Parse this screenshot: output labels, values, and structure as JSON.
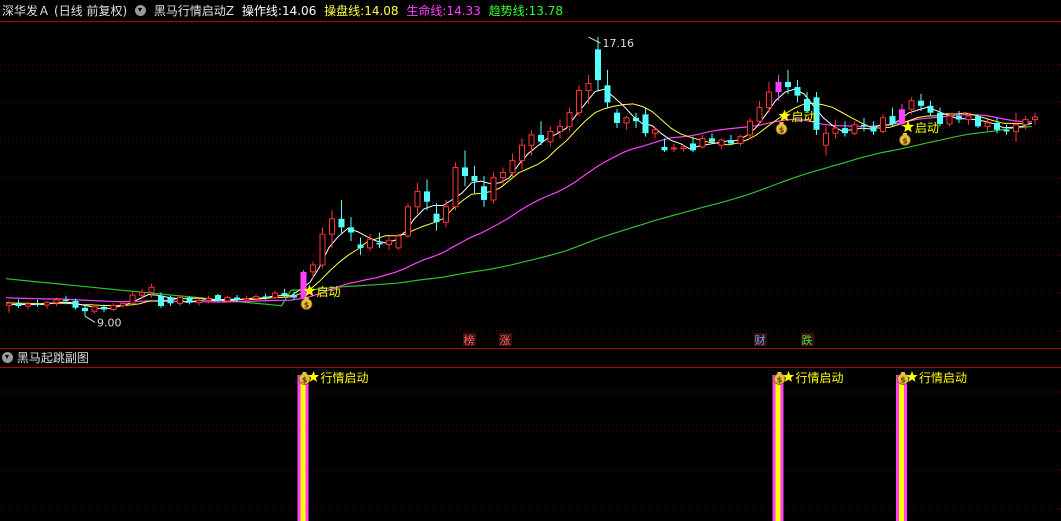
{
  "header": {
    "stock_name": "深华发Ａ",
    "period": "(日线 前复权)",
    "indicator_name": "黑马行情启动Z",
    "lines": [
      {
        "label": "操作线:",
        "value": "14.06",
        "color": "#ffffff"
      },
      {
        "label": "操盘线:",
        "value": "14.08",
        "color": "#ffff40"
      },
      {
        "label": "生命线:",
        "value": "14.33",
        "color": "#ff40ff"
      },
      {
        "label": "趋势线:",
        "value": "13.78",
        "color": "#30ff30"
      }
    ]
  },
  "subpanel": {
    "title": "黑马起跳副图"
  },
  "annotations": {
    "high_label": "17.16",
    "low_label": "9.00",
    "signal_text": "启动",
    "sub_signal_text": "行情启动",
    "tags": [
      {
        "text": "榜",
        "color": "#ff6060"
      },
      {
        "text": "涨",
        "color": "#ff6060"
      },
      {
        "text": "财",
        "color": "#6aa0ff"
      },
      {
        "text": "跌",
        "color": "#40e040"
      }
    ]
  },
  "colors": {
    "up": "#ff3232",
    "down": "#54ffff",
    "grid": "#7a0000",
    "divider": "#b40000",
    "signal_bar": "#ff40ff",
    "sub_bar_outer": "#ff40ff",
    "sub_bar_inner": "#ffff00",
    "star": "#ffff00",
    "bag": "#e8c040"
  },
  "chart_data": {
    "type": "candlestick",
    "y_range": [
      8.6,
      17.6
    ],
    "candles": [
      {
        "o": 9.32,
        "h": 9.45,
        "l": 9.1,
        "c": 9.38
      },
      {
        "o": 9.38,
        "h": 9.5,
        "l": 9.25,
        "c": 9.3
      },
      {
        "o": 9.3,
        "h": 9.42,
        "l": 9.2,
        "c": 9.36
      },
      {
        "o": 9.36,
        "h": 9.48,
        "l": 9.28,
        "c": 9.33
      },
      {
        "o": 9.33,
        "h": 9.45,
        "l": 9.22,
        "c": 9.4
      },
      {
        "o": 9.4,
        "h": 9.55,
        "l": 9.3,
        "c": 9.48
      },
      {
        "o": 9.48,
        "h": 9.6,
        "l": 9.35,
        "c": 9.45
      },
      {
        "o": 9.45,
        "h": 9.52,
        "l": 9.2,
        "c": 9.25
      },
      {
        "o": 9.25,
        "h": 9.35,
        "l": 9.0,
        "c": 9.15
      },
      {
        "o": 9.15,
        "h": 9.35,
        "l": 9.08,
        "c": 9.28
      },
      {
        "o": 9.28,
        "h": 9.34,
        "l": 9.12,
        "c": 9.2
      },
      {
        "o": 9.2,
        "h": 9.38,
        "l": 9.15,
        "c": 9.32
      },
      {
        "o": 9.32,
        "h": 9.45,
        "l": 9.26,
        "c": 9.38
      },
      {
        "o": 9.38,
        "h": 9.7,
        "l": 9.3,
        "c": 9.62
      },
      {
        "o": 9.62,
        "h": 9.8,
        "l": 9.5,
        "c": 9.7
      },
      {
        "o": 9.7,
        "h": 9.95,
        "l": 9.55,
        "c": 9.85
      },
      {
        "o": 9.6,
        "h": 9.7,
        "l": 9.25,
        "c": 9.3
      },
      {
        "o": 9.55,
        "h": 9.6,
        "l": 9.3,
        "c": 9.38
      },
      {
        "o": 9.38,
        "h": 9.62,
        "l": 9.3,
        "c": 9.55
      },
      {
        "o": 9.55,
        "h": 9.58,
        "l": 9.35,
        "c": 9.4
      },
      {
        "o": 9.4,
        "h": 9.52,
        "l": 9.32,
        "c": 9.46
      },
      {
        "o": 9.46,
        "h": 9.6,
        "l": 9.38,
        "c": 9.52
      },
      {
        "o": 9.62,
        "h": 9.66,
        "l": 9.42,
        "c": 9.45
      },
      {
        "o": 9.45,
        "h": 9.6,
        "l": 9.4,
        "c": 9.55
      },
      {
        "o": 9.55,
        "h": 9.62,
        "l": 9.42,
        "c": 9.48
      },
      {
        "o": 9.48,
        "h": 9.6,
        "l": 9.4,
        "c": 9.52
      },
      {
        "o": 9.52,
        "h": 9.64,
        "l": 9.44,
        "c": 9.58
      },
      {
        "o": 9.58,
        "h": 9.66,
        "l": 9.48,
        "c": 9.55
      },
      {
        "o": 9.55,
        "h": 9.75,
        "l": 9.5,
        "c": 9.68
      },
      {
        "o": 9.68,
        "h": 9.8,
        "l": 9.56,
        "c": 9.62
      },
      {
        "o": 9.62,
        "h": 9.72,
        "l": 9.5,
        "c": 9.55
      },
      {
        "o": 9.52,
        "h": 10.35,
        "l": 9.5,
        "c": 10.3
      },
      {
        "o": 10.3,
        "h": 10.6,
        "l": 10.1,
        "c": 10.5
      },
      {
        "o": 10.5,
        "h": 11.6,
        "l": 10.4,
        "c": 11.4
      },
      {
        "o": 11.4,
        "h": 12.1,
        "l": 11.0,
        "c": 11.85
      },
      {
        "o": 11.85,
        "h": 12.4,
        "l": 11.4,
        "c": 11.6
      },
      {
        "o": 11.6,
        "h": 11.9,
        "l": 11.2,
        "c": 11.45
      },
      {
        "o": 11.1,
        "h": 11.3,
        "l": 10.8,
        "c": 11.0
      },
      {
        "o": 11.0,
        "h": 11.4,
        "l": 10.9,
        "c": 11.25
      },
      {
        "o": 11.15,
        "h": 11.45,
        "l": 11.0,
        "c": 11.1
      },
      {
        "o": 11.1,
        "h": 11.35,
        "l": 10.95,
        "c": 11.22
      },
      {
        "o": 11.0,
        "h": 11.4,
        "l": 10.95,
        "c": 11.35
      },
      {
        "o": 11.35,
        "h": 12.3,
        "l": 11.3,
        "c": 12.2
      },
      {
        "o": 12.2,
        "h": 12.9,
        "l": 12.0,
        "c": 12.65
      },
      {
        "o": 12.65,
        "h": 13.0,
        "l": 12.1,
        "c": 12.35
      },
      {
        "o": 12.0,
        "h": 12.3,
        "l": 11.5,
        "c": 11.75
      },
      {
        "o": 11.75,
        "h": 12.4,
        "l": 11.6,
        "c": 12.2
      },
      {
        "o": 12.2,
        "h": 13.5,
        "l": 12.1,
        "c": 13.35
      },
      {
        "o": 13.35,
        "h": 13.85,
        "l": 12.8,
        "c": 13.1
      },
      {
        "o": 13.1,
        "h": 13.4,
        "l": 12.6,
        "c": 12.95
      },
      {
        "o": 12.8,
        "h": 13.1,
        "l": 12.2,
        "c": 12.4
      },
      {
        "o": 12.4,
        "h": 13.2,
        "l": 12.3,
        "c": 13.05
      },
      {
        "o": 13.05,
        "h": 13.35,
        "l": 12.85,
        "c": 13.2
      },
      {
        "o": 13.2,
        "h": 13.75,
        "l": 13.05,
        "c": 13.55
      },
      {
        "o": 13.55,
        "h": 14.2,
        "l": 13.3,
        "c": 14.0
      },
      {
        "o": 14.0,
        "h": 14.45,
        "l": 13.7,
        "c": 14.3
      },
      {
        "o": 14.3,
        "h": 14.7,
        "l": 14.0,
        "c": 14.1
      },
      {
        "o": 14.1,
        "h": 14.55,
        "l": 13.95,
        "c": 14.4
      },
      {
        "o": 14.4,
        "h": 14.75,
        "l": 14.2,
        "c": 14.55
      },
      {
        "o": 14.55,
        "h": 15.1,
        "l": 14.4,
        "c": 14.95
      },
      {
        "o": 14.95,
        "h": 15.75,
        "l": 14.85,
        "c": 15.6
      },
      {
        "o": 15.6,
        "h": 16.05,
        "l": 15.2,
        "c": 15.8
      },
      {
        "o": 16.8,
        "h": 17.16,
        "l": 15.6,
        "c": 15.9
      },
      {
        "o": 15.75,
        "h": 16.2,
        "l": 15.1,
        "c": 15.25
      },
      {
        "o": 14.95,
        "h": 15.05,
        "l": 14.5,
        "c": 14.65
      },
      {
        "o": 14.65,
        "h": 14.85,
        "l": 14.45,
        "c": 14.8
      },
      {
        "o": 14.8,
        "h": 14.95,
        "l": 14.5,
        "c": 14.7
      },
      {
        "o": 14.9,
        "h": 15.1,
        "l": 14.25,
        "c": 14.35
      },
      {
        "o": 14.35,
        "h": 14.55,
        "l": 14.2,
        "c": 14.45
      },
      {
        "o": 13.95,
        "h": 14.2,
        "l": 13.8,
        "c": 13.85
      },
      {
        "o": 13.9,
        "h": 14.05,
        "l": 13.8,
        "c": 13.92
      },
      {
        "o": 13.9,
        "h": 14.0,
        "l": 13.82,
        "c": 13.95
      },
      {
        "o": 14.05,
        "h": 14.25,
        "l": 13.8,
        "c": 13.85
      },
      {
        "o": 13.95,
        "h": 14.3,
        "l": 13.9,
        "c": 14.2
      },
      {
        "o": 14.2,
        "h": 14.35,
        "l": 14.05,
        "c": 14.1
      },
      {
        "o": 14.0,
        "h": 14.2,
        "l": 13.9,
        "c": 14.15
      },
      {
        "o": 14.15,
        "h": 14.3,
        "l": 14.0,
        "c": 14.05
      },
      {
        "o": 14.05,
        "h": 14.3,
        "l": 13.98,
        "c": 14.25
      },
      {
        "o": 14.3,
        "h": 14.8,
        "l": 14.2,
        "c": 14.7
      },
      {
        "o": 14.7,
        "h": 15.3,
        "l": 14.6,
        "c": 15.1
      },
      {
        "o": 15.1,
        "h": 15.85,
        "l": 14.95,
        "c": 15.55
      },
      {
        "o": 15.55,
        "h": 16.05,
        "l": 15.3,
        "c": 15.85
      },
      {
        "o": 15.85,
        "h": 16.2,
        "l": 15.5,
        "c": 15.7
      },
      {
        "o": 15.7,
        "h": 15.9,
        "l": 15.25,
        "c": 15.45
      },
      {
        "o": 15.35,
        "h": 15.55,
        "l": 14.95,
        "c": 15.0
      },
      {
        "o": 15.4,
        "h": 15.55,
        "l": 14.3,
        "c": 14.45
      },
      {
        "o": 14.0,
        "h": 14.55,
        "l": 13.7,
        "c": 14.35
      },
      {
        "o": 14.35,
        "h": 14.75,
        "l": 14.2,
        "c": 14.5
      },
      {
        "o": 14.5,
        "h": 14.7,
        "l": 14.25,
        "c": 14.35
      },
      {
        "o": 14.35,
        "h": 14.7,
        "l": 14.3,
        "c": 14.6
      },
      {
        "o": 14.6,
        "h": 14.8,
        "l": 14.4,
        "c": 14.55
      },
      {
        "o": 14.55,
        "h": 14.7,
        "l": 14.3,
        "c": 14.4
      },
      {
        "o": 14.4,
        "h": 14.9,
        "l": 14.35,
        "c": 14.8
      },
      {
        "o": 14.85,
        "h": 15.1,
        "l": 14.55,
        "c": 14.62
      },
      {
        "o": 14.62,
        "h": 15.2,
        "l": 14.55,
        "c": 15.05
      },
      {
        "o": 15.05,
        "h": 15.4,
        "l": 14.9,
        "c": 15.3
      },
      {
        "o": 15.3,
        "h": 15.5,
        "l": 15.0,
        "c": 15.15
      },
      {
        "o": 15.15,
        "h": 15.3,
        "l": 14.85,
        "c": 14.95
      },
      {
        "o": 14.95,
        "h": 15.1,
        "l": 14.55,
        "c": 14.62
      },
      {
        "o": 14.62,
        "h": 14.95,
        "l": 14.55,
        "c": 14.85
      },
      {
        "o": 14.85,
        "h": 15.0,
        "l": 14.65,
        "c": 14.75
      },
      {
        "o": 14.75,
        "h": 14.95,
        "l": 14.6,
        "c": 14.85
      },
      {
        "o": 14.85,
        "h": 14.9,
        "l": 14.5,
        "c": 14.55
      },
      {
        "o": 14.55,
        "h": 14.75,
        "l": 14.4,
        "c": 14.65
      },
      {
        "o": 14.65,
        "h": 14.8,
        "l": 14.35,
        "c": 14.45
      },
      {
        "o": 14.45,
        "h": 14.6,
        "l": 14.3,
        "c": 14.4
      },
      {
        "o": 14.4,
        "h": 14.95,
        "l": 14.1,
        "c": 14.6
      },
      {
        "o": 14.6,
        "h": 14.85,
        "l": 14.45,
        "c": 14.75
      },
      {
        "o": 14.75,
        "h": 14.95,
        "l": 14.6,
        "c": 14.82
      }
    ],
    "signal_indices": [
      31,
      81,
      94
    ]
  }
}
